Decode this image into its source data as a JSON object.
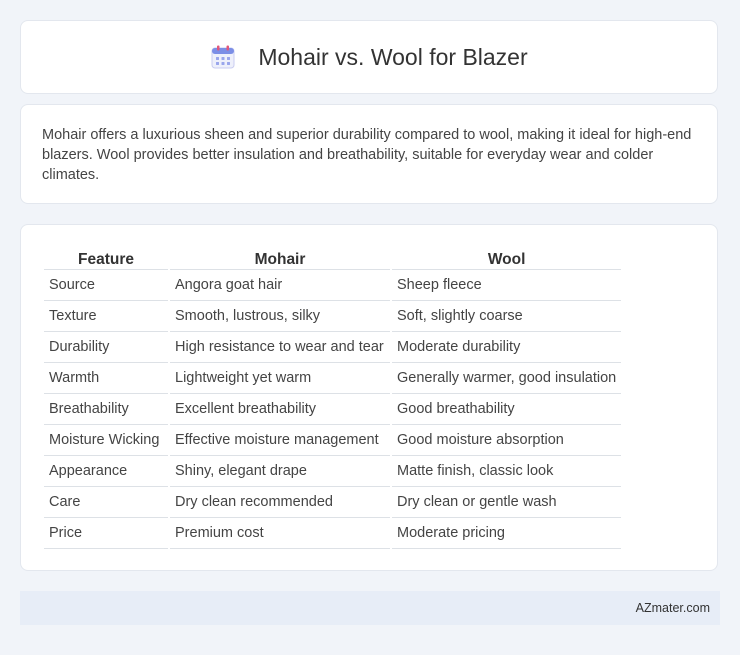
{
  "header": {
    "title": "Mohair vs. Wool for Blazer",
    "icon": "calendar-icon"
  },
  "summary": {
    "text": "Mohair offers a luxurious sheen and superior durability compared to wool, making it ideal for high-end blazers. Wool provides better insulation and breathability, suitable for everyday wear and colder climates."
  },
  "table": {
    "headers": [
      "Feature",
      "Mohair",
      "Wool"
    ],
    "rows": [
      [
        "Source",
        "Angora goat hair",
        "Sheep fleece"
      ],
      [
        "Texture",
        "Smooth, lustrous, silky",
        "Soft, slightly coarse"
      ],
      [
        "Durability",
        "High resistance to wear and tear",
        "Moderate durability"
      ],
      [
        "Warmth",
        "Lightweight yet warm",
        "Generally warmer, good insulation"
      ],
      [
        "Breathability",
        "Excellent breathability",
        "Good breathability"
      ],
      [
        "Moisture Wicking",
        "Effective moisture management",
        "Good moisture absorption"
      ],
      [
        "Appearance",
        "Shiny, elegant drape",
        "Matte finish, classic look"
      ],
      [
        "Care",
        "Dry clean recommended",
        "Dry clean or gentle wash"
      ],
      [
        "Price",
        "Premium cost",
        "Moderate pricing"
      ]
    ]
  },
  "footer": {
    "brand": "AZmater.com"
  }
}
